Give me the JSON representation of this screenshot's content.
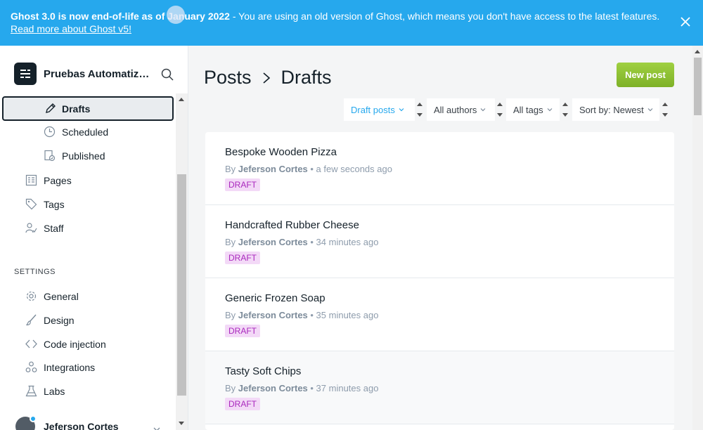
{
  "banner": {
    "bold_text": "Ghost 3.0 is now end-of-life as of January 2022",
    "text": " - You are using an old version of Ghost, which means you don't have access to the latest features. ",
    "link": "Read more about Ghost v5!"
  },
  "sidebar": {
    "site_name": "Pruebas Automatizadas",
    "sub_items": [
      {
        "label": "Drafts",
        "icon": "pencil-icon"
      },
      {
        "label": "Scheduled",
        "icon": "clock-icon"
      },
      {
        "label": "Published",
        "icon": "published-icon"
      }
    ],
    "items": [
      {
        "label": "Pages",
        "icon": "pages-icon"
      },
      {
        "label": "Tags",
        "icon": "tag-icon"
      },
      {
        "label": "Staff",
        "icon": "staff-icon"
      }
    ],
    "settings_label": "SETTINGS",
    "settings_items": [
      {
        "label": "General",
        "icon": "gear-icon"
      },
      {
        "label": "Design",
        "icon": "brush-icon"
      },
      {
        "label": "Code injection",
        "icon": "code-icon"
      },
      {
        "label": "Integrations",
        "icon": "integrations-icon"
      },
      {
        "label": "Labs",
        "icon": "flask-icon"
      }
    ],
    "user_name": "Jeferson Cortes"
  },
  "main": {
    "breadcrumb": {
      "parent": "Posts",
      "current": "Drafts"
    },
    "new_post_label": "New post",
    "filters": {
      "type": "Draft posts",
      "author": "All authors",
      "tag": "All tags",
      "sort": "Sort by: Newest"
    },
    "posts": [
      {
        "title": "Bespoke Wooden Pizza",
        "by": "By ",
        "author": "Jeferson Cortes",
        "time": " • a few seconds ago",
        "status": "DRAFT"
      },
      {
        "title": "Handcrafted Rubber Cheese",
        "by": "By ",
        "author": "Jeferson Cortes",
        "time": " • 34 minutes ago",
        "status": "DRAFT"
      },
      {
        "title": "Generic Frozen Soap",
        "by": "By ",
        "author": "Jeferson Cortes",
        "time": " • 35 minutes ago",
        "status": "DRAFT"
      },
      {
        "title": "Tasty Soft Chips",
        "by": "By ",
        "author": "Jeferson Cortes",
        "time": " • 37 minutes ago",
        "status": "DRAFT"
      }
    ]
  },
  "colors": {
    "banner": "#26a8ed",
    "accent": "#26a8ed",
    "new_post": "#85b733",
    "draft_badge_bg": "#f3d9f7",
    "draft_badge_text": "#a928bd"
  }
}
